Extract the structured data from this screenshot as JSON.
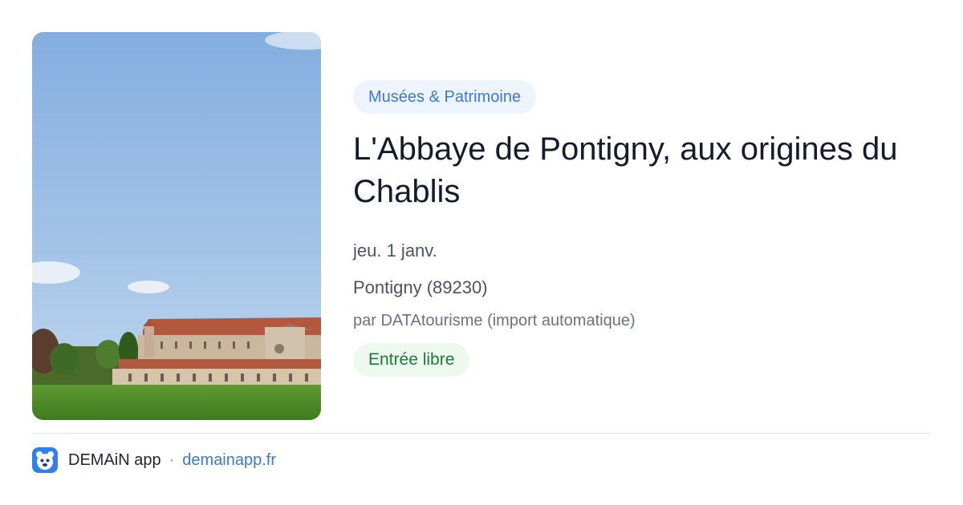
{
  "image": {
    "subject": "abbey-photo"
  },
  "category": {
    "label": "Musées & Patrimoine"
  },
  "event": {
    "title": "L'Abbaye de Pontigny, aux origines du Chablis",
    "date": "jeu. 1 janv.",
    "location": "Pontigny (89230)",
    "author": "par DATAtourisme (import automatique)",
    "price": "Entrée libre"
  },
  "footer": {
    "app_icon": "demain-app-icon",
    "app_name": "DEMAiN app",
    "separator": "·",
    "url": "demainapp.fr"
  },
  "colors": {
    "category_bg": "#eef4fd",
    "category_text": "#3f78cf",
    "price_bg": "#edf8ef",
    "price_text": "#1f7a3a",
    "title_text": "#131b2c",
    "link": "#3f78cf"
  }
}
